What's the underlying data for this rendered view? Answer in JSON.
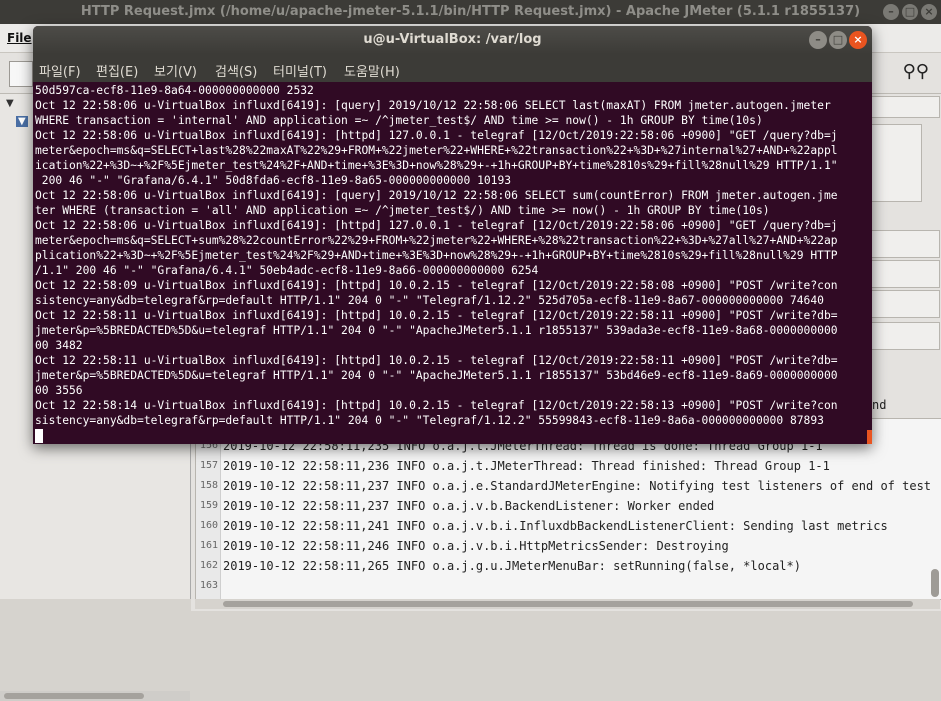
{
  "jmeter": {
    "window_title": "HTTP Request.jmx (/home/u/apache-jmeter-5.1.1/bin/HTTP Request.jmx) - Apache JMeter (5.1.1 r1855137)",
    "menu_file": "File",
    "log_partial_line_end": "nd",
    "log_lines": [
      {
        "num": "156",
        "text": "2019-10-12 22:58:11,235 INFO o.a.j.t.JMeterThread: Thread is done: Thread Group 1-1"
      },
      {
        "num": "157",
        "text": "2019-10-12 22:58:11,236 INFO o.a.j.t.JMeterThread: Thread finished: Thread Group 1-1"
      },
      {
        "num": "158",
        "text": "2019-10-12 22:58:11,237 INFO o.a.j.e.StandardJMeterEngine: Notifying test listeners of end of test"
      },
      {
        "num": "159",
        "text": "2019-10-12 22:58:11,237 INFO o.a.j.v.b.BackendListener: Worker ended"
      },
      {
        "num": "160",
        "text": "2019-10-12 22:58:11,241 INFO o.a.j.v.b.i.InfluxdbBackendListenerClient: Sending last metrics"
      },
      {
        "num": "161",
        "text": "2019-10-12 22:58:11,246 INFO o.a.j.v.b.i.HttpMetricsSender: Destroying"
      },
      {
        "num": "162",
        "text": "2019-10-12 22:58:11,265 INFO o.a.j.g.u.JMeterMenuBar: setRunning(false, *local*)"
      },
      {
        "num": "163",
        "text": ""
      }
    ]
  },
  "terminal": {
    "title": "u@u-VirtualBox: /var/log",
    "menu": [
      "파일(F)",
      "편집(E)",
      "보기(V)",
      "검색(S)",
      "터미널(T)",
      "도움말(H)"
    ],
    "lines": [
      "50d597ca-ecf8-11e9-8a64-000000000000 2532",
      "Oct 12 22:58:06 u-VirtualBox influxd[6419]: [query] 2019/10/12 22:58:06 SELECT last(maxAT) FROM jmeter.autogen.jmeter",
      "WHERE transaction = 'internal' AND application =~ /^jmeter_test$/ AND time >= now() - 1h GROUP BY time(10s)",
      "Oct 12 22:58:06 u-VirtualBox influxd[6419]: [httpd] 127.0.0.1 - telegraf [12/Oct/2019:22:58:06 +0900] \"GET /query?db=j",
      "meter&epoch=ms&q=SELECT+last%28%22maxAT%22%29+FROM+%22jmeter%22+WHERE+%22transaction%22+%3D+%27internal%27+AND+%22appl",
      "ication%22+%3D~+%2F%5Ejmeter_test%24%2F+AND+time+%3E%3D+now%28%29+-+1h+GROUP+BY+time%2810s%29+fill%28null%29 HTTP/1.1\"",
      " 200 46 \"-\" \"Grafana/6.4.1\" 50d8fda6-ecf8-11e9-8a65-000000000000 10193",
      "Oct 12 22:58:06 u-VirtualBox influxd[6419]: [query] 2019/10/12 22:58:06 SELECT sum(countError) FROM jmeter.autogen.jme",
      "ter WHERE (transaction = 'all' AND application =~ /^jmeter_test$/) AND time >= now() - 1h GROUP BY time(10s)",
      "Oct 12 22:58:06 u-VirtualBox influxd[6419]: [httpd] 127.0.0.1 - telegraf [12/Oct/2019:22:58:06 +0900] \"GET /query?db=j",
      "meter&epoch=ms&q=SELECT+sum%28%22countError%22%29+FROM+%22jmeter%22+WHERE+%28%22transaction%22+%3D+%27all%27+AND+%22ap",
      "plication%22+%3D~+%2F%5Ejmeter_test%24%2F%29+AND+time+%3E%3D+now%28%29+-+1h+GROUP+BY+time%2810s%29+fill%28null%29 HTTP",
      "/1.1\" 200 46 \"-\" \"Grafana/6.4.1\" 50eb4adc-ecf8-11e9-8a66-000000000000 6254",
      "Oct 12 22:58:09 u-VirtualBox influxd[6419]: [httpd] 10.0.2.15 - telegraf [12/Oct/2019:22:58:08 +0900] \"POST /write?con",
      "sistency=any&db=telegraf&rp=default HTTP/1.1\" 204 0 \"-\" \"Telegraf/1.12.2\" 525d705a-ecf8-11e9-8a67-000000000000 74640",
      "Oct 12 22:58:11 u-VirtualBox influxd[6419]: [httpd] 10.0.2.15 - telegraf [12/Oct/2019:22:58:11 +0900] \"POST /write?db=",
      "jmeter&p=%5BREDACTED%5D&u=telegraf HTTP/1.1\" 204 0 \"-\" \"ApacheJMeter5.1.1 r1855137\" 539ada3e-ecf8-11e9-8a68-0000000000",
      "00 3482",
      "Oct 12 22:58:11 u-VirtualBox influxd[6419]: [httpd] 10.0.2.15 - telegraf [12/Oct/2019:22:58:11 +0900] \"POST /write?db=",
      "jmeter&p=%5BREDACTED%5D&u=telegraf HTTP/1.1\" 204 0 \"-\" \"ApacheJMeter5.1.1 r1855137\" 53bd46e9-ecf8-11e9-8a69-0000000000",
      "00 3556",
      "Oct 12 22:58:14 u-VirtualBox influxd[6419]: [httpd] 10.0.2.15 - telegraf [12/Oct/2019:22:58:13 +0900] \"POST /write?con",
      "sistency=any&db=telegraf&rp=default HTTP/1.1\" 204 0 \"-\" \"Telegraf/1.12.2\" 55599843-ecf8-11e9-8a6a-000000000000 87893"
    ]
  }
}
